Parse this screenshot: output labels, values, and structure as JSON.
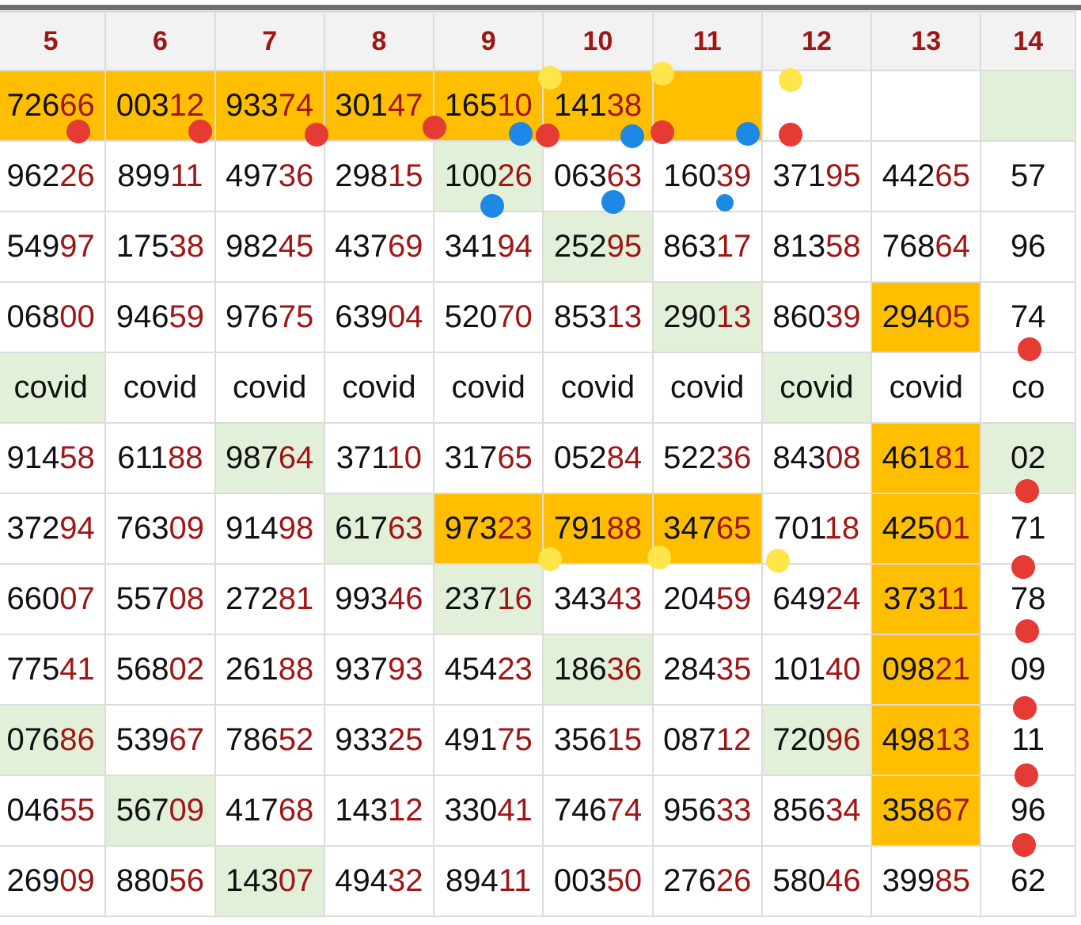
{
  "colors": {
    "orange_highlight": "#ffbf00",
    "green_highlight": "#e2f0d9",
    "header_text": "#a01616",
    "last_digits_text": "#a01616",
    "dot_red": "#e63a35",
    "dot_blue": "#1e88e5",
    "dot_yellow": "#fde54a"
  },
  "columns": [
    "5",
    "6",
    "7",
    "8",
    "9",
    "10",
    "11",
    "12",
    "13",
    "14"
  ],
  "rows": [
    [
      "72666",
      "00312",
      "93374",
      "30147",
      "16510",
      "14138",
      "",
      "",
      "",
      ""
    ],
    [
      "96226",
      "89911",
      "49736",
      "29815",
      "10026",
      "06363",
      "16039",
      "37195",
      "44265",
      "57"
    ],
    [
      "54997",
      "17538",
      "98245",
      "43769",
      "34194",
      "25295",
      "86317",
      "81358",
      "76864",
      "96"
    ],
    [
      "06800",
      "94659",
      "97675",
      "63904",
      "52070",
      "85313",
      "29013",
      "86039",
      "29405",
      "74"
    ],
    [
      "covid",
      "covid",
      "covid",
      "covid",
      "covid",
      "covid",
      "covid",
      "covid",
      "covid",
      "co"
    ],
    [
      "91458",
      "61188",
      "98764",
      "37110",
      "31765",
      "05284",
      "52236",
      "84308",
      "46181",
      "02"
    ],
    [
      "37294",
      "76309",
      "91498",
      "61763",
      "97323",
      "79188",
      "34765",
      "70118",
      "42501",
      "71"
    ],
    [
      "66007",
      "55708",
      "27281",
      "99346",
      "23716",
      "34343",
      "20459",
      "64924",
      "37311",
      "78"
    ],
    [
      "77541",
      "56802",
      "26188",
      "93793",
      "45423",
      "18636",
      "28435",
      "10140",
      "09821",
      "09"
    ],
    [
      "07686",
      "53967",
      "78652",
      "93325",
      "49175",
      "35615",
      "08712",
      "72096",
      "49813",
      "11"
    ],
    [
      "04655",
      "56709",
      "41768",
      "14312",
      "33041",
      "74674",
      "95633",
      "85634",
      "35867",
      "96"
    ],
    [
      "26909",
      "88056",
      "14307",
      "49432",
      "89411",
      "00350",
      "27626",
      "58046",
      "39985",
      "62"
    ]
  ],
  "highlights": [
    [
      "orange",
      "orange",
      "orange",
      "orange",
      "orange",
      "orange",
      "orange",
      "",
      "",
      "green"
    ],
    [
      "",
      "",
      "",
      "",
      "green",
      "",
      "",
      "",
      "",
      ""
    ],
    [
      "",
      "",
      "",
      "",
      "",
      "green",
      "",
      "",
      "",
      ""
    ],
    [
      "",
      "",
      "",
      "",
      "",
      "",
      "green",
      "",
      "orange",
      ""
    ],
    [
      "green",
      "",
      "",
      "",
      "",
      "",
      "",
      "green",
      "",
      ""
    ],
    [
      "",
      "",
      "green",
      "",
      "",
      "",
      "",
      "",
      "orange",
      "green"
    ],
    [
      "",
      "",
      "",
      "green",
      "orange",
      "orange",
      "orange",
      "",
      "orange",
      ""
    ],
    [
      "",
      "",
      "",
      "",
      "green",
      "",
      "",
      "",
      "orange",
      ""
    ],
    [
      "",
      "",
      "",
      "",
      "",
      "green",
      "",
      "",
      "orange",
      ""
    ],
    [
      "green",
      "",
      "",
      "",
      "",
      "",
      "",
      "green",
      "orange",
      ""
    ],
    [
      "",
      "green",
      "",
      "",
      "",
      "",
      "",
      "",
      "orange",
      ""
    ],
    [
      "",
      "",
      "green",
      "",
      "",
      "",
      "",
      "",
      "",
      ""
    ]
  ],
  "markers": [
    {
      "color": "red",
      "name": "red-dot"
    },
    {
      "color": "red",
      "name": "red-dot"
    },
    {
      "color": "red",
      "name": "red-dot"
    },
    {
      "color": "red",
      "name": "red-dot"
    },
    {
      "color": "red",
      "name": "red-dot"
    },
    {
      "color": "red",
      "name": "red-dot"
    },
    {
      "color": "red",
      "name": "red-dot"
    },
    {
      "color": "yellow",
      "name": "yellow-dot"
    },
    {
      "color": "yellow",
      "name": "yellow-dot"
    },
    {
      "color": "yellow",
      "name": "yellow-dot"
    },
    {
      "color": "blue",
      "name": "blue-dot"
    },
    {
      "color": "blue",
      "name": "blue-dot"
    },
    {
      "color": "blue",
      "name": "blue-dot"
    },
    {
      "color": "blue",
      "name": "blue-dot"
    },
    {
      "color": "blue",
      "name": "blue-dot"
    },
    {
      "color": "blue",
      "name": "blue-dot"
    },
    {
      "color": "red",
      "name": "red-dot"
    },
    {
      "color": "red",
      "name": "red-dot"
    },
    {
      "color": "red",
      "name": "red-dot"
    },
    {
      "color": "red",
      "name": "red-dot"
    },
    {
      "color": "red",
      "name": "red-dot"
    },
    {
      "color": "red",
      "name": "red-dot"
    },
    {
      "color": "red",
      "name": "red-dot"
    },
    {
      "color": "yellow",
      "name": "yellow-dot"
    },
    {
      "color": "yellow",
      "name": "yellow-dot"
    },
    {
      "color": "yellow",
      "name": "yellow-dot"
    }
  ]
}
